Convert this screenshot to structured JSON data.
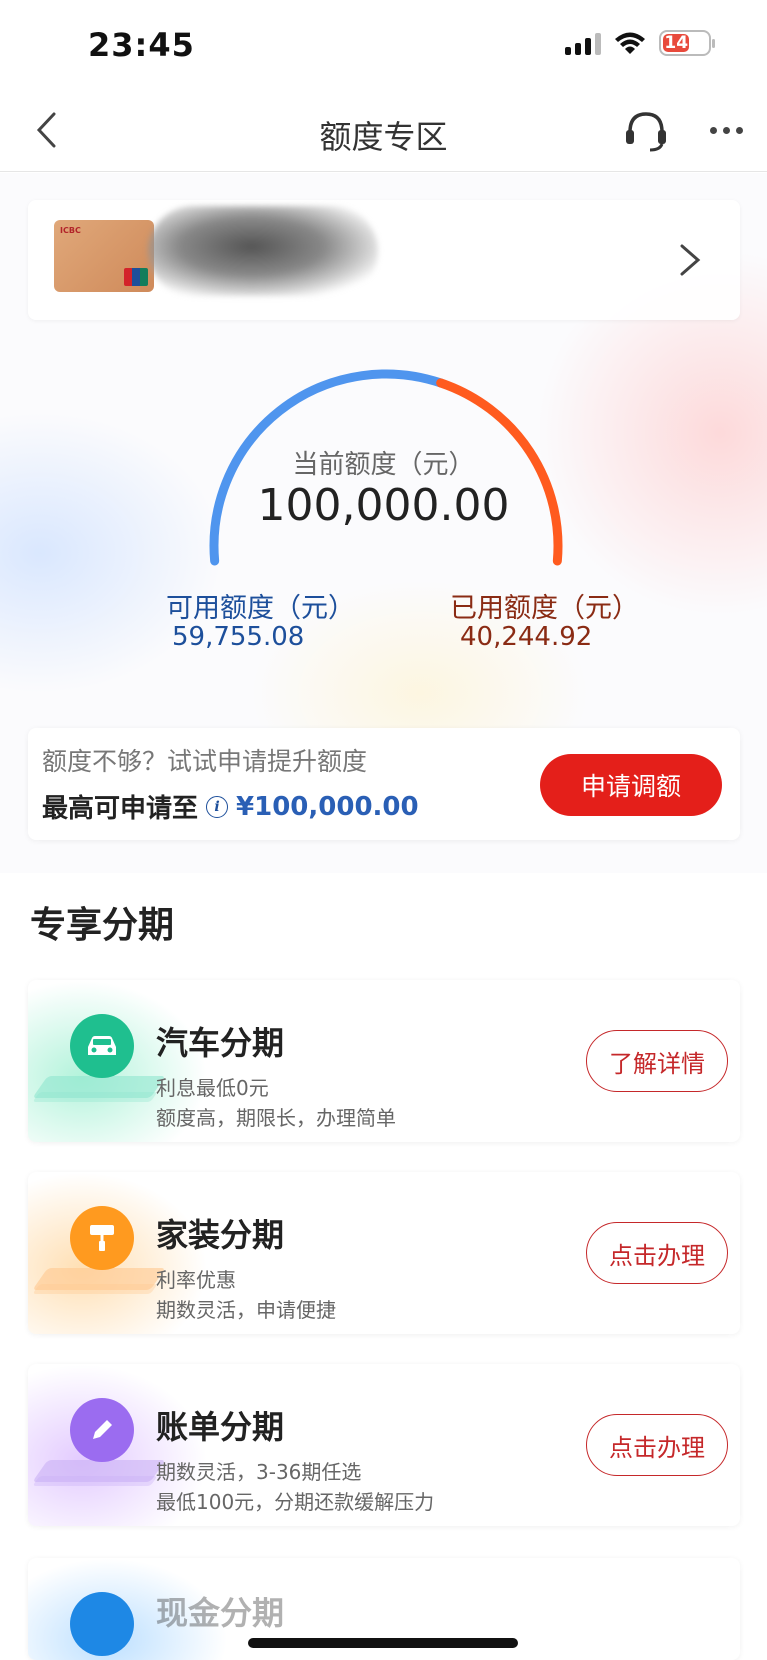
{
  "status_bar": {
    "time": "23:45",
    "battery": "14"
  },
  "nav": {
    "title": "额度专区"
  },
  "gauge": {
    "label": "当前额度（元）",
    "total": "100,000.00",
    "available_label": "可用额度（元）",
    "available_value": "59,755.08",
    "used_label": "已用额度（元）",
    "used_value": "40,244.92",
    "available_fraction": 0.5976,
    "colors": {
      "available": "#4f95ee",
      "used": "#ff5b1f"
    }
  },
  "increase": {
    "hint": "额度不够？试试申请提升额度",
    "max_label": "最高可申请至",
    "max_amount": "¥100,000.00",
    "apply_label": "申请调额"
  },
  "section": {
    "title": "专享分期"
  },
  "plans": [
    {
      "title": "汽车分期",
      "sub1": "利息最低0元",
      "sub2": "额度高，期限长，办理简单",
      "button": "了解详情",
      "icon": "car-icon",
      "color": "#1fbf8f"
    },
    {
      "title": "家装分期",
      "sub1": "利率优惠",
      "sub2": "期数灵活，申请便捷",
      "button": "点击办理",
      "icon": "paint-roller-icon",
      "color": "#ff9a1f"
    },
    {
      "title": "账单分期",
      "sub1": "期数灵活，3-36期任选",
      "sub2": "最低100元，分期还款缓解压力",
      "button": "点击办理",
      "icon": "pencil-icon",
      "color": "#9b6cf0"
    }
  ],
  "partial_plan": {
    "title": "现金分期"
  }
}
